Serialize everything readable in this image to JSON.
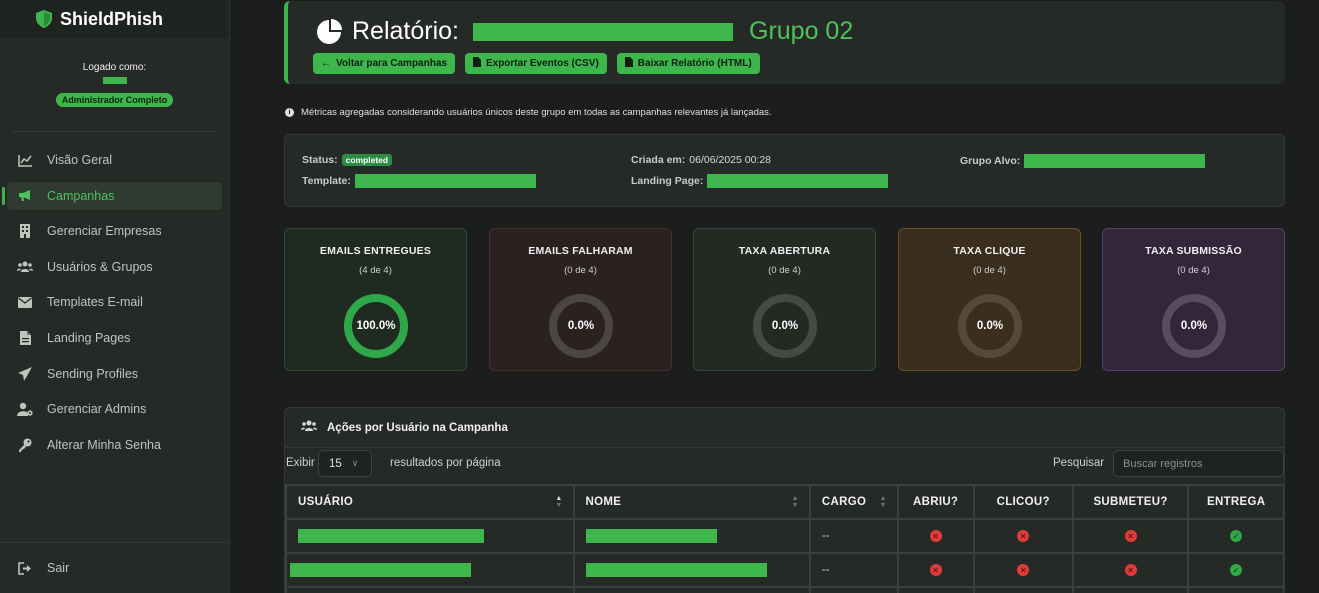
{
  "app": {
    "name": "ShieldPhish"
  },
  "user": {
    "logged_label": "Logado como:",
    "role": "Administrador Completo"
  },
  "nav": [
    {
      "label": "Visão Geral",
      "icon": "chart-line-icon",
      "active": false
    },
    {
      "label": "Campanhas",
      "icon": "bullhorn-icon",
      "active": true
    },
    {
      "label": "Gerenciar Empresas",
      "icon": "building-icon",
      "active": false
    },
    {
      "label": "Usuários & Grupos",
      "icon": "users-icon",
      "active": false
    },
    {
      "label": "Templates E-mail",
      "icon": "envelope-icon",
      "active": false
    },
    {
      "label": "Landing Pages",
      "icon": "file-icon",
      "active": false
    },
    {
      "label": "Sending Profiles",
      "icon": "paper-plane-icon",
      "active": false
    },
    {
      "label": "Gerenciar Admins",
      "icon": "user-gear-icon",
      "active": false
    },
    {
      "label": "Alterar Minha Senha",
      "icon": "key-icon",
      "active": false
    }
  ],
  "logout": {
    "label": "Sair"
  },
  "header": {
    "title": "Relatório:",
    "group": "Grupo 02",
    "buttons": {
      "back": "Voltar para Campanhas",
      "export": "Exportar Eventos (CSV)",
      "download": "Baixar Relatório (HTML)"
    }
  },
  "info": "Métricas agregadas considerando usuários únicos deste grupo em todas as campanhas relevantes já lançadas.",
  "details": {
    "status_label": "Status:",
    "status_value": "completed",
    "template_label": "Template:",
    "created_label": "Criada em:",
    "created_value": "06/06/2025 00:28",
    "landing_label": "Landing Page:",
    "target_label": "Grupo Alvo:"
  },
  "stats": [
    {
      "title": "EMAILS ENTREGUES",
      "sub": "(4 de 4)",
      "pct_label": "100.0%",
      "fraction": 1.0,
      "color": "#2fa84a",
      "bg": "#1f2a21",
      "border": "#2f4a33",
      "track": "#3a403b"
    },
    {
      "title": "EMAILS FALHARAM",
      "sub": "(0 de 4)",
      "pct_label": "0.0%",
      "fraction": 0.0,
      "color": "#e23a3a",
      "bg": "#2a2120",
      "border": "#4a2b28",
      "track": "#4a4644"
    },
    {
      "title": "TAXA ABERTURA",
      "sub": "(0 de 4)",
      "pct_label": "0.0%",
      "fraction": 0.0,
      "color": "#2fa84a",
      "bg": "#222a23",
      "border": "#33463a",
      "track": "#454a45"
    },
    {
      "title": "TAXA CLIQUE",
      "sub": "(0 de 4)",
      "pct_label": "0.0%",
      "fraction": 0.0,
      "color": "#e8a33a",
      "bg": "#3a2e1f",
      "border": "#6b4f25",
      "track": "#55493a"
    },
    {
      "title": "TAXA SUBMISSÃO",
      "sub": "(0 de 4)",
      "pct_label": "0.0%",
      "fraction": 0.0,
      "color": "#9b59b6",
      "bg": "#33253a",
      "border": "#55406a",
      "track": "#5a4a62"
    }
  ],
  "table": {
    "title": "Ações por Usuário na Campanha",
    "show_label": "Exibir",
    "page_size": "15",
    "per_page_label": "resultados por página",
    "search_label": "Pesquisar",
    "search_placeholder": "Buscar registros",
    "columns": [
      "USUÁRIO",
      "NOME",
      "CARGO",
      "ABRIU?",
      "CLICOU?",
      "SUBMETEU?",
      "ENTREGA"
    ],
    "rows": [
      {
        "cargo": "--",
        "abriu": false,
        "clicou": false,
        "submeteu": false,
        "entrega": true
      },
      {
        "cargo": "--",
        "abriu": false,
        "clicou": false,
        "submeteu": false,
        "entrega": true
      }
    ]
  }
}
